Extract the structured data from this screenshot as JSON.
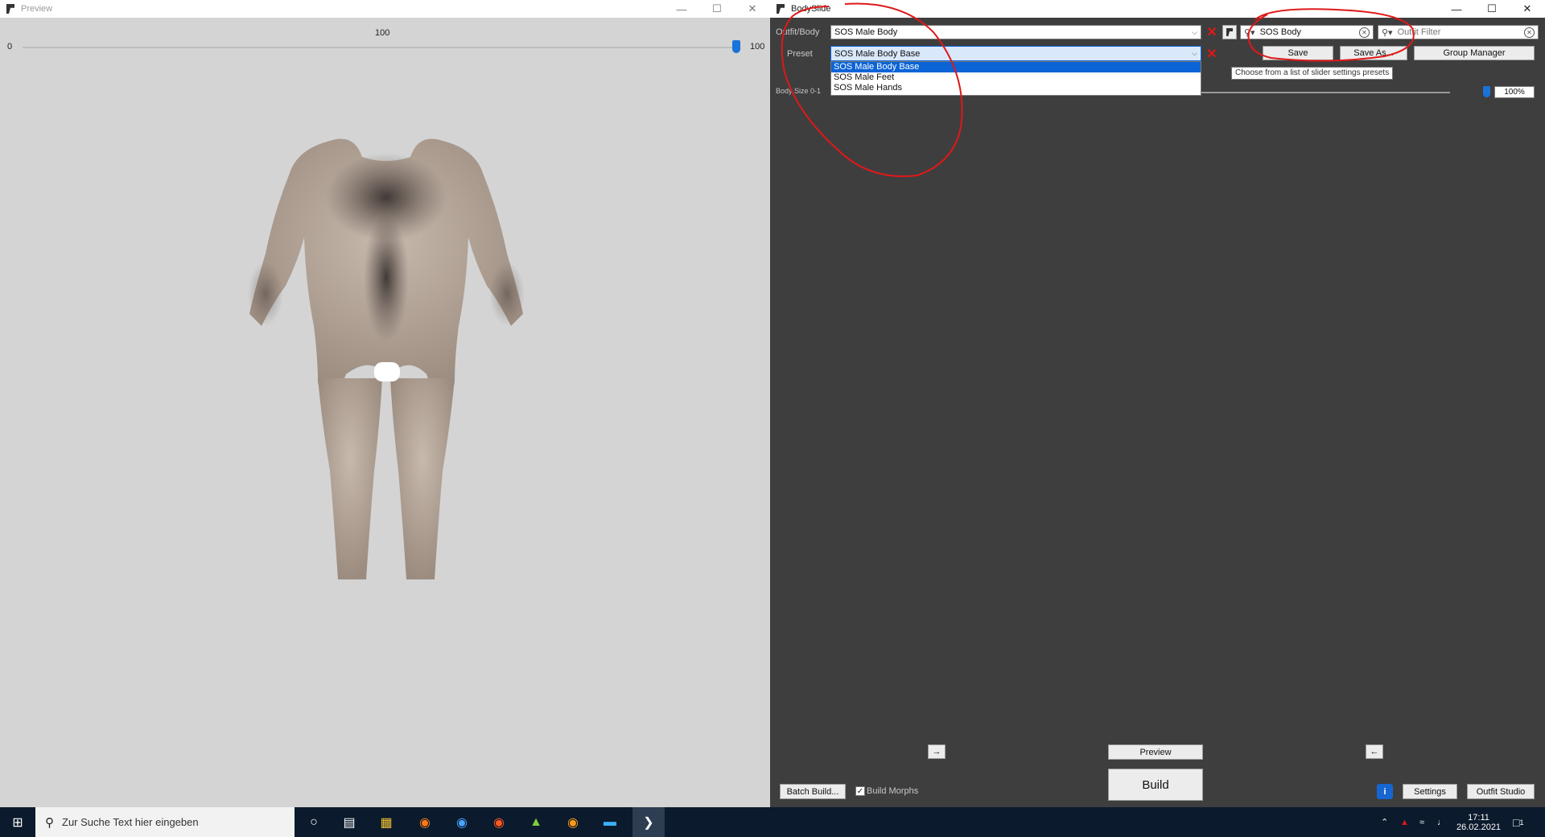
{
  "preview_window": {
    "title": "Preview",
    "zoom": {
      "min_label": "0",
      "value_label": "100",
      "max_label": "100",
      "value": 100
    }
  },
  "bodyslide_window": {
    "title": "BodySlide",
    "outfit_label": "Outfit/Body",
    "outfit_value": "SOS Male Body",
    "preset_label": "Preset",
    "preset_value": "SOS Male Body Base",
    "preset_options": [
      "SOS Male Body Base",
      "SOS Male Feet",
      "SOS Male Hands"
    ],
    "group_filter_value": "SOS Body",
    "outfit_filter_placeholder": "Outfit Filter",
    "buttons": {
      "save": "Save",
      "save_as": "Save As...",
      "group_manager": "Group Manager",
      "preview": "Preview",
      "build": "Build",
      "batch_build": "Batch Build...",
      "settings": "Settings",
      "outfit_studio": "Outfit Studio",
      "arrow_right": "→",
      "arrow_left": "←"
    },
    "tooltip": "Choose from a list of slider settings presets",
    "body_size_label": "Body Size 0-1",
    "body_size_value": "100%",
    "build_morphs_label": "Build Morphs",
    "build_morphs_checked": true
  },
  "taskbar": {
    "search_placeholder": "Zur Suche Text hier eingeben",
    "time": "17:11",
    "date": "26.02.2021",
    "notification_count": "1"
  },
  "colors": {
    "annotation_red": "#e01818",
    "selection_blue": "#0a64d6",
    "panel_dark": "#3e3e3e"
  }
}
